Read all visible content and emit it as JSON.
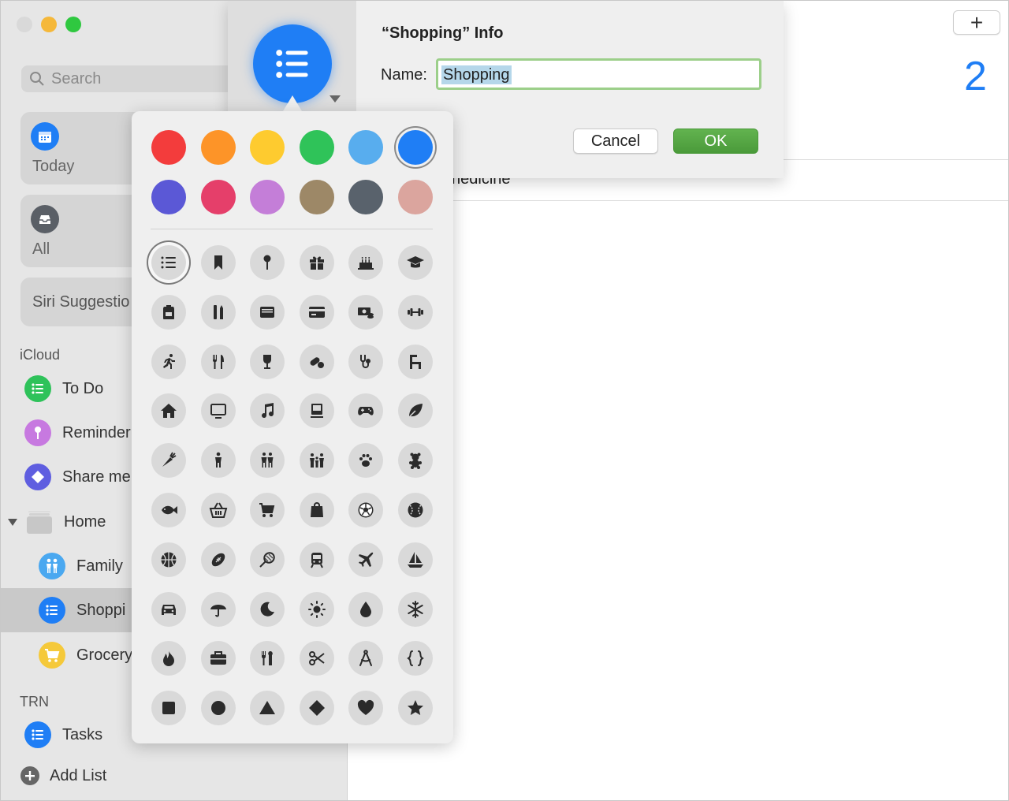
{
  "colors": {
    "accent": "#1f7ef5",
    "ok_button": "#52a340",
    "input_focus": "#9ccf8a",
    "selection_highlight": "#b5d7ea"
  },
  "window": {
    "traffic_lights": [
      "#d9d9d9",
      "#f5b83a",
      "#2fc840"
    ]
  },
  "sidebar": {
    "search_placeholder": "Search",
    "smart_lists": [
      {
        "label": "Today",
        "icon": "calendar-icon",
        "color": "#1f7ef5"
      },
      {
        "label": "All",
        "icon": "tray-icon",
        "color": "#5a5f66"
      },
      {
        "label": "Siri Suggestio",
        "icon": "",
        "color": ""
      }
    ],
    "sections": [
      {
        "title": "iCloud"
      },
      {
        "title": "TRN"
      }
    ],
    "icloud_lists": [
      {
        "label": "To Do",
        "icon": "list-icon",
        "color": "#2ec25a"
      },
      {
        "label": "Reminder",
        "icon": "pin-icon",
        "color": "#c779e0"
      },
      {
        "label": "Share me",
        "icon": "diamond-icon",
        "color": "#5f5ee0"
      }
    ],
    "group": {
      "label": "Home",
      "icon": "folder-icon",
      "expanded": true
    },
    "group_lists": [
      {
        "label": "Family",
        "icon": "people-icon",
        "color": "#4aa8f0"
      },
      {
        "label": "Shoppi",
        "icon": "list-icon",
        "color": "#1f7ef5",
        "selected": true
      },
      {
        "label": "Grocery",
        "icon": "cart-icon",
        "color": "#f5c93a"
      }
    ],
    "trn_lists": [
      {
        "label": "Tasks",
        "icon": "list-icon",
        "color": "#1f7ef5"
      }
    ],
    "add_list_label": "Add List"
  },
  "main": {
    "count": "2",
    "peek_item": "nedicine",
    "add_button_label": "+"
  },
  "dialog": {
    "title": "“Shopping” Info",
    "name_label": "Name:",
    "name_value": "Shopping",
    "cancel_label": "Cancel",
    "ok_label": "OK",
    "selected_icon": "list-icon",
    "selected_color": "#1f7ef5"
  },
  "picker": {
    "colors": [
      {
        "name": "red",
        "hex": "#f33c3c"
      },
      {
        "name": "orange",
        "hex": "#fd9428"
      },
      {
        "name": "yellow",
        "hex": "#fecb2f"
      },
      {
        "name": "green",
        "hex": "#2fc359"
      },
      {
        "name": "light-blue",
        "hex": "#58adee"
      },
      {
        "name": "blue",
        "hex": "#1f7ef5",
        "selected": true
      },
      {
        "name": "indigo",
        "hex": "#5b58d6"
      },
      {
        "name": "pink",
        "hex": "#e53f6a"
      },
      {
        "name": "purple",
        "hex": "#c47ed8"
      },
      {
        "name": "brown",
        "hex": "#9d8867"
      },
      {
        "name": "slate",
        "hex": "#59626c"
      },
      {
        "name": "rose",
        "hex": "#dba59e"
      }
    ],
    "symbols": [
      "list-icon",
      "bookmark-icon",
      "pin-icon",
      "gift-icon",
      "birthday-cake-icon",
      "graduation-cap-icon",
      "backpack-icon",
      "ruler-pencil-icon",
      "document-tray-icon",
      "credit-card-icon",
      "money-icon",
      "dumbbell-icon",
      "running-figure-icon",
      "fork-knife-icon",
      "wine-glass-icon",
      "pills-icon",
      "stethoscope-icon",
      "chair-icon",
      "house-icon",
      "tv-icon",
      "music-note-icon",
      "desktop-icon",
      "gamepad-icon",
      "leaf-icon",
      "carrot-icon",
      "person-icon",
      "two-people-icon",
      "family-icon",
      "pawprint-icon",
      "teddy-bear-icon",
      "fish-icon",
      "basket-icon",
      "cart-icon",
      "shopping-bag-icon",
      "soccer-ball-icon",
      "baseball-icon",
      "basketball-icon",
      "football-icon",
      "tennis-racket-icon",
      "tram-icon",
      "airplane-icon",
      "sailboat-icon",
      "car-icon",
      "umbrella-icon",
      "moon-icon",
      "sun-icon",
      "drop-icon",
      "snowflake-icon",
      "flame-icon",
      "briefcase-icon",
      "tools-icon",
      "scissors-icon",
      "compass-icon",
      "curly-braces-icon",
      "square-icon",
      "circle-icon",
      "triangle-icon",
      "diamond-icon",
      "heart-icon",
      "star-icon"
    ],
    "selected_symbol": "list-icon"
  }
}
